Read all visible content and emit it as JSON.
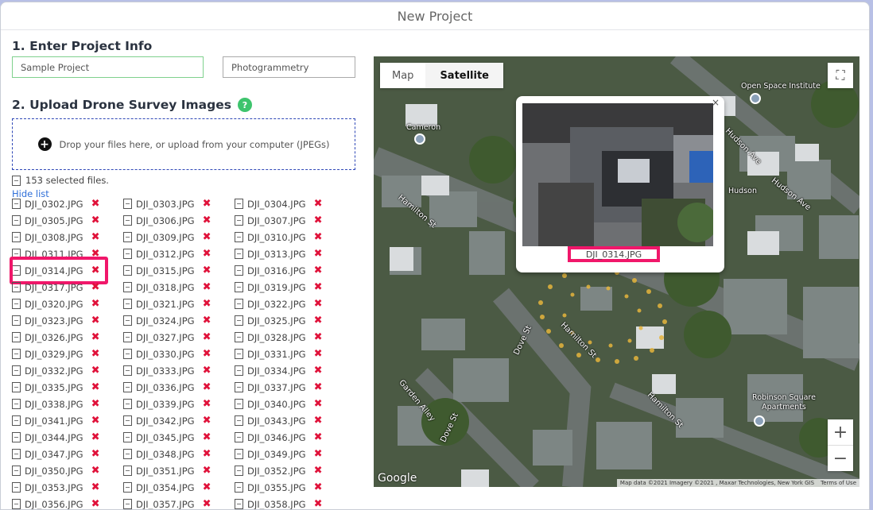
{
  "window": {
    "title": "New Project"
  },
  "section1": {
    "heading": "1. Enter Project Info",
    "name_value": "Sample Project",
    "type_value": "Photogrammetry"
  },
  "section2": {
    "heading": "2. Upload Drone Survey Images",
    "help_icon": "?",
    "drop_text": "Drop your files here, or upload from your computer (JPEGs)",
    "selected_text": "153 selected files.",
    "hide_link": "Hide list"
  },
  "files": [
    "DJI_0302.JPG",
    "DJI_0303.JPG",
    "DJI_0304.JPG",
    "DJI_0305.JPG",
    "DJI_0306.JPG",
    "DJI_0307.JPG",
    "DJI_0308.JPG",
    "DJI_0309.JPG",
    "DJI_0310.JPG",
    "DJI_0311.JPG",
    "DJI_0312.JPG",
    "DJI_0313.JPG",
    "DJI_0314.JPG",
    "DJI_0315.JPG",
    "DJI_0316.JPG",
    "DJI_0317.JPG",
    "DJI_0318.JPG",
    "DJI_0319.JPG",
    "DJI_0320.JPG",
    "DJI_0321.JPG",
    "DJI_0322.JPG",
    "DJI_0323.JPG",
    "DJI_0324.JPG",
    "DJI_0325.JPG",
    "DJI_0326.JPG",
    "DJI_0327.JPG",
    "DJI_0328.JPG",
    "DJI_0329.JPG",
    "DJI_0330.JPG",
    "DJI_0331.JPG",
    "DJI_0332.JPG",
    "DJI_0333.JPG",
    "DJI_0334.JPG",
    "DJI_0335.JPG",
    "DJI_0336.JPG",
    "DJI_0337.JPG",
    "DJI_0338.JPG",
    "DJI_0339.JPG",
    "DJI_0340.JPG",
    "DJI_0341.JPG",
    "DJI_0342.JPG",
    "DJI_0343.JPG",
    "DJI_0344.JPG",
    "DJI_0345.JPG",
    "DJI_0346.JPG",
    "DJI_0347.JPG",
    "DJI_0348.JPG",
    "DJI_0349.JPG",
    "DJI_0350.JPG",
    "DJI_0351.JPG",
    "DJI_0352.JPG",
    "DJI_0353.JPG",
    "DJI_0354.JPG",
    "DJI_0355.JPG",
    "DJI_0356.JPG",
    "DJI_0357.JPG",
    "DJI_0358.JPG"
  ],
  "remove_icon": "✖",
  "highlighted_file": "DJI_0314.JPG",
  "map": {
    "tab_map": "Map",
    "tab_satellite": "Satellite",
    "active_tab": "Satellite",
    "popup_label": "DJI_0314.JPG",
    "popup_close": "×",
    "zoom_in": "+",
    "zoom_out": "−",
    "fullscreen_icon": "⛶",
    "google": "Google",
    "attribution": "Map data ©2021 Imagery ©2021 , Maxar Technologies, New York GIS",
    "terms": "Terms of Use",
    "labels": {
      "open_space": "Open Space Institute",
      "cameron": "Cameron",
      "hudson": "Hudson",
      "hudson_ave": "Hudson Ave",
      "hamilton1": "Hamilton St",
      "hamilton2": "Hamilton St",
      "hamilton3": "Hamilton St",
      "dove1": "Dove St",
      "dove2": "Dove St",
      "garden": "Garden Alley",
      "robinson": "Robinson Square Apartments"
    }
  },
  "colors": {
    "accent": "#2f48b7",
    "remove": "#e0123a",
    "highlight": "#f0176a",
    "help": "#3ec46d",
    "name_border": "#7fd18d"
  }
}
